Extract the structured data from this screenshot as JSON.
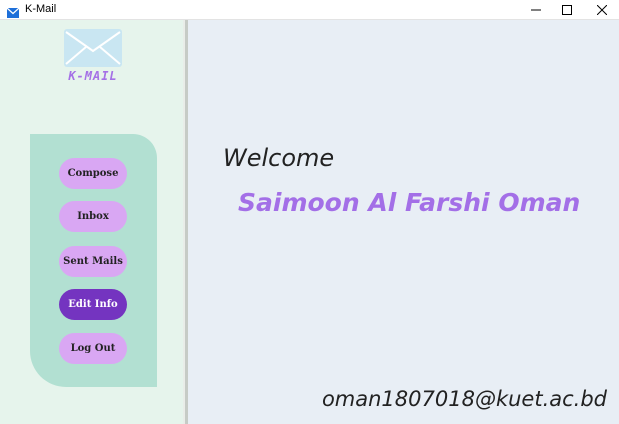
{
  "window": {
    "title": "K-Mail",
    "app_icon": "envelope-icon",
    "controls": [
      "minimize-icon",
      "maximize-icon",
      "close-icon"
    ]
  },
  "sidebar": {
    "logo_text": "K-MAIL",
    "logo_icon": "envelope-icon",
    "buttons": [
      {
        "label": "Compose",
        "active": false
      },
      {
        "label": "Inbox",
        "active": false
      },
      {
        "label": "Sent Mails",
        "active": false
      },
      {
        "label": "Edit Info",
        "active": true
      },
      {
        "label": "Log Out",
        "active": false
      }
    ]
  },
  "main": {
    "welcome": "Welcome",
    "user_name": "Saimoon Al Farshi Oman",
    "email": "oman1807018@kuet.ac.bd"
  },
  "colors": {
    "sidebar_bg": "#e6f4ec",
    "nav_panel": "#b2e0d2",
    "button": "#d9a7f3",
    "button_active": "#7434c0",
    "accent": "#a36fe7",
    "main_bg": "#e8eef5"
  }
}
